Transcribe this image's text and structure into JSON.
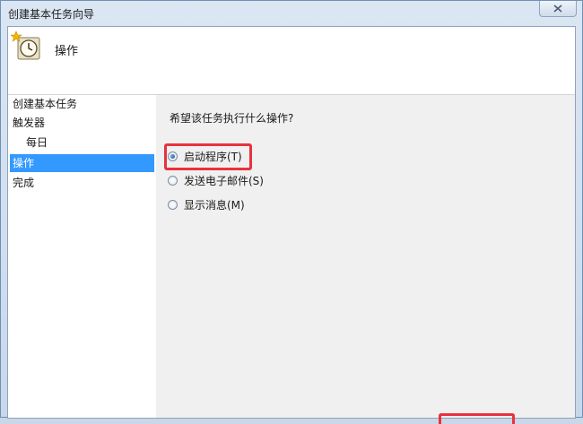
{
  "window": {
    "title": "创建基本任务向导"
  },
  "header": {
    "title": "操作",
    "icon": "scheduled-task-clock-icon"
  },
  "nav": {
    "items": [
      {
        "label": "创建基本任务",
        "selected": false
      },
      {
        "label": "触发器",
        "selected": false
      },
      {
        "label": "每日",
        "selected": false
      },
      {
        "label": "操作",
        "selected": true
      },
      {
        "label": "完成",
        "selected": false
      }
    ]
  },
  "content": {
    "question": "希望该任务执行什么操作?",
    "options": [
      {
        "label": "启动程序(T)",
        "checked": true
      },
      {
        "label": "发送电子邮件(S)",
        "checked": false
      },
      {
        "label": "显示消息(M)",
        "checked": false
      }
    ]
  },
  "colors": {
    "selection": "#3399ff",
    "highlight_annotation": "#e8323e"
  }
}
